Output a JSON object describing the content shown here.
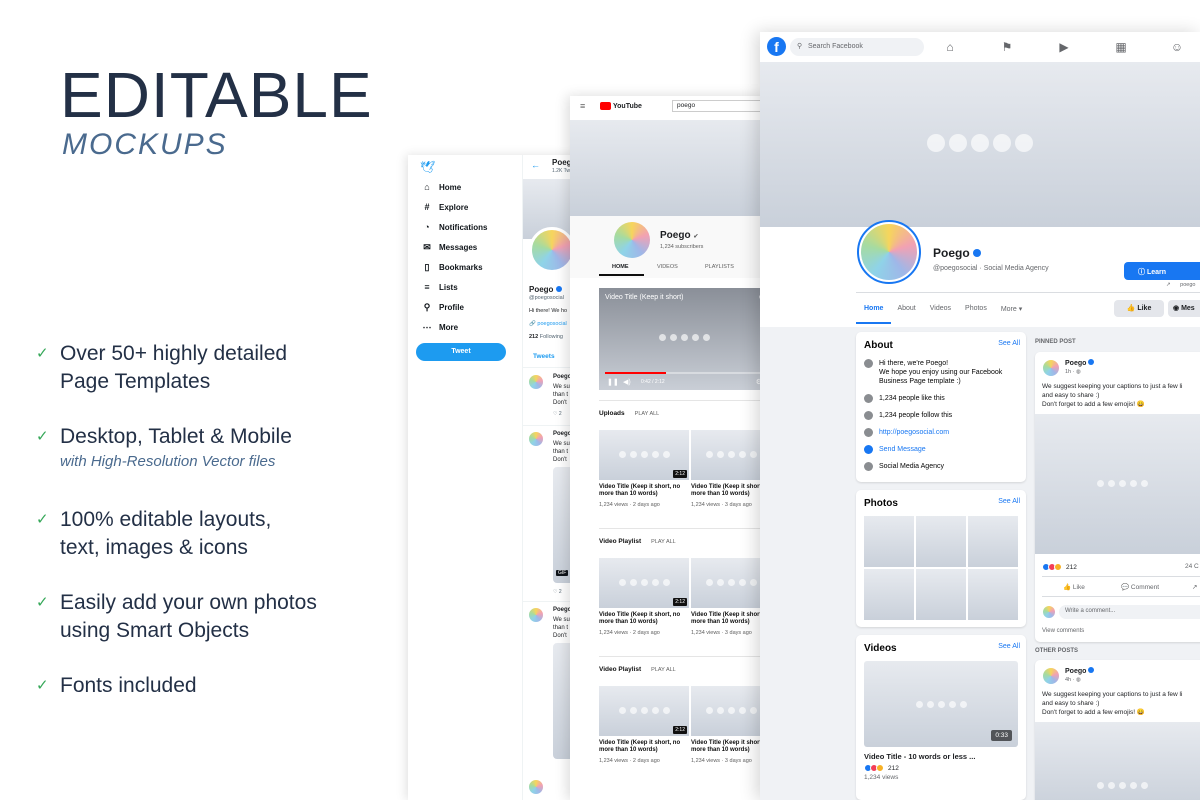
{
  "hero": {
    "title": "EDITABLE",
    "subtitle": "MOCKUPS"
  },
  "features": [
    {
      "line1": "Over 50+ highly detailed",
      "line2": "Page Templates",
      "note": ""
    },
    {
      "line1": "Desktop, Tablet & Mobile",
      "line2": "",
      "note": "with High-Resolution Vector files"
    },
    {
      "line1": "100% editable layouts,",
      "line2": "text, images & icons",
      "note": ""
    },
    {
      "line1": "Easily add your own photos",
      "line2": "using Smart Objects",
      "note": ""
    },
    {
      "line1": "Fonts included",
      "line2": "",
      "note": ""
    }
  ],
  "twitter": {
    "nav": [
      "Home",
      "Explore",
      "Notifications",
      "Messages",
      "Bookmarks",
      "Lists",
      "Profile",
      "More"
    ],
    "tweet_button": "Tweet",
    "header_name": "Poego",
    "header_count": "1.2K Tw",
    "profile_name": "Poego",
    "handle": "@poegosocial",
    "bio": "Hi there! We ho",
    "link": "poegosocial",
    "following": "212",
    "following_label": "Following",
    "tab": "Tweets",
    "tweet_author": "Poego",
    "tweet_lines": [
      "We su",
      "than t",
      "Don't"
    ],
    "gif": "GIF",
    "stat": "2"
  },
  "youtube": {
    "logo": "YouTube",
    "search": "poego",
    "channel": "Poego",
    "subscribers": "1,234 subscribers",
    "tabs": [
      "HOME",
      "VIDEOS",
      "PLAYLISTS"
    ],
    "player_title": "Video Title (Keep it short)",
    "player_time": "0:42 / 2:12",
    "sections": [
      {
        "title": "Uploads",
        "action": "PLAY ALL"
      },
      {
        "title": "Video Playlist",
        "action": "PLAY ALL"
      },
      {
        "title": "Video Playlist",
        "action": "PLAY ALL"
      }
    ],
    "video_title_a": "Video Title (Keep it short, no more than 10 words)",
    "video_title_b": "Video Title (Keep it short, d more than 10 words)",
    "meta_a": "1,234 views · 2 days ago",
    "meta_b": "1,234 views · 3 days ago",
    "duration": "2:12"
  },
  "facebook": {
    "search_placeholder": "Search Facebook",
    "page_name": "Poego",
    "page_sub": "@poegosocial · Social Media Agency",
    "cta": "Learn",
    "cta_sub": "poego",
    "tabs": [
      "Home",
      "About",
      "Videos",
      "Photos",
      "More"
    ],
    "like": "Like",
    "message": "Mes",
    "about_title": "About",
    "see_all": "See All",
    "about_intro": [
      "Hi there, we're Poego!",
      "We hope you enjoy using our Facebook",
      "Business Page template :)"
    ],
    "about_likes": "1,234 people like this",
    "about_follows": "1,234 people follow this",
    "about_url": "http://poegosocial.com",
    "about_message": "Send Message",
    "about_category": "Social Media Agency",
    "photos_title": "Photos",
    "videos_title": "Videos",
    "video_caption": "Video Title - 10 words or less ...",
    "video_duration": "0:33",
    "video_reacts": "212",
    "video_views": "1,234 views",
    "pinned_label": "PINNED POST",
    "other_label": "OTHER POSTS",
    "post_author": "Poego",
    "pinned_time": "1h · ",
    "other_time": "4h · ",
    "post_text": [
      "We suggest keeping your captions to just a few li",
      "and easy to share :)",
      "Don't forget to add a few emojis! 😄"
    ],
    "post_reacts": "212",
    "post_comments": "24 C",
    "action_like": "Like",
    "action_comment": "Comment",
    "comment_placeholder": "Write a comment...",
    "view_comments": "View comments"
  },
  "colors": {
    "accent": "#1877f2",
    "navy": "#233046",
    "check": "#37a85a",
    "twitter": "#1d9bf0",
    "youtube_red": "#ff0000"
  }
}
